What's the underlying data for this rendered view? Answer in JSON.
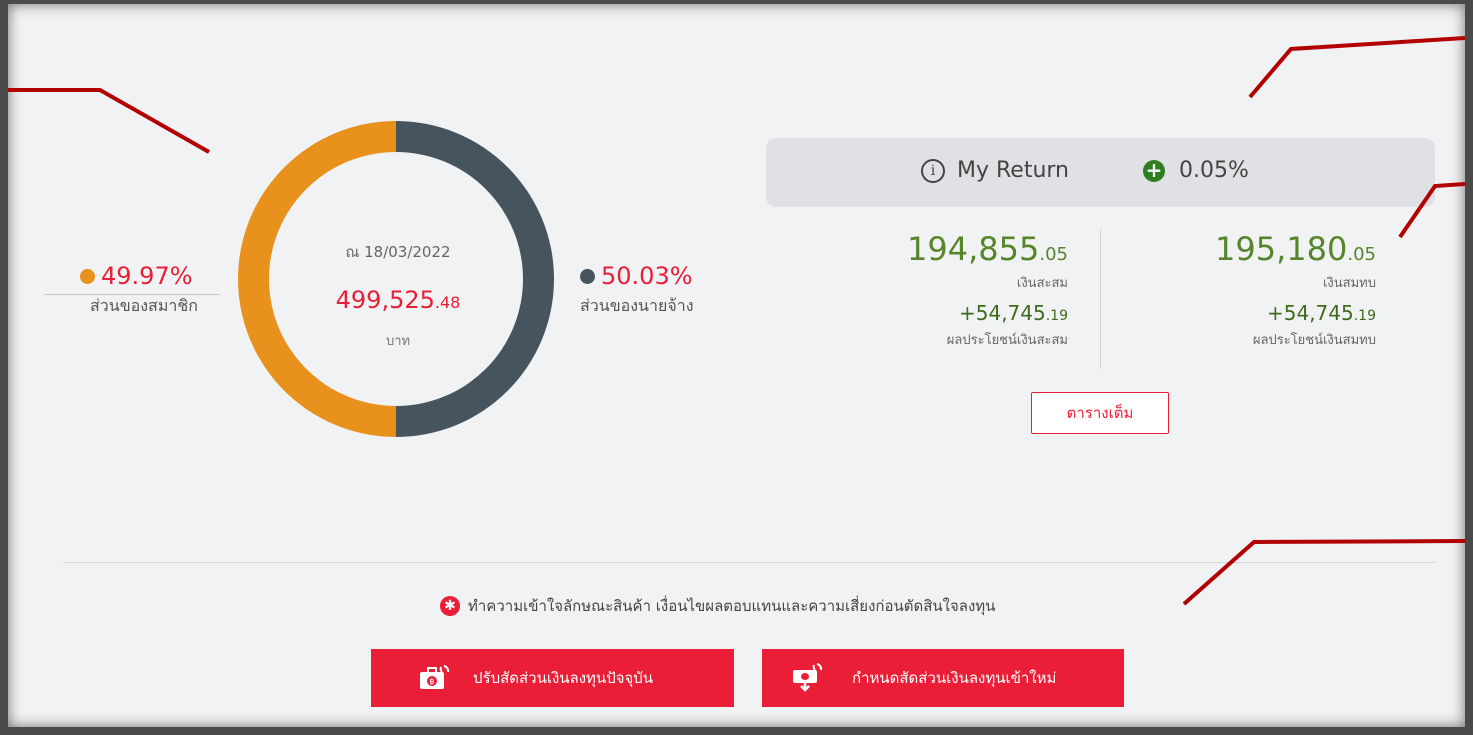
{
  "chart_data": {
    "type": "pie",
    "categories": [
      "ส่วนของสมาชิก",
      "ส่วนของนายจ้าง"
    ],
    "values": [
      49.97,
      50.03
    ],
    "colors": [
      "#e8911c",
      "#46545e"
    ]
  },
  "summary": {
    "date_label": "ณ 18/03/2022",
    "total_int": "499,525",
    "total_dec": ".48",
    "unit": "บาท"
  },
  "legend": {
    "member": {
      "percent": "49.97%",
      "label": "ส่วนของสมาชิก",
      "color": "#e8911c"
    },
    "employer": {
      "percent": "50.03%",
      "label": "ส่วนของนายจ้าง",
      "color": "#46545e"
    }
  },
  "return_bar": {
    "info_icon": "info-icon",
    "label": "My Return",
    "plus_icon": "plus-circle-icon",
    "value": "0.05%"
  },
  "savings": {
    "amount_int": "194,855",
    "amount_dec": ".05",
    "label": "เงินสะสม",
    "gain_int": "+54,745",
    "gain_dec": ".19",
    "gain_label": "ผลประโยชน์เงินสะสม"
  },
  "contribution": {
    "amount_int": "195,180",
    "amount_dec": ".05",
    "label": "เงินสมทบ",
    "gain_int": "+54,745",
    "gain_dec": ".19",
    "gain_label": "ผลประโยชน์เงินสมทบ"
  },
  "full_table_button": "ตารางเต็ม",
  "notice": {
    "icon": "asterisk-icon",
    "text": "ทำความเข้าใจลักษณะสินค้า เงื่อนไขผลตอบแทนและความเสี่ยงก่อนตัดสินใจลงทุน"
  },
  "buttons": {
    "adjust_label": "ปรับสัดส่วนเงินลงทุนปัจจุบัน",
    "new_label": "กำหนดสัดส่วนเงินลงทุนเข้าใหม่"
  },
  "colors": {
    "accent": "#ea1e36",
    "positive": "#56852a",
    "annotation": "#b30000"
  }
}
